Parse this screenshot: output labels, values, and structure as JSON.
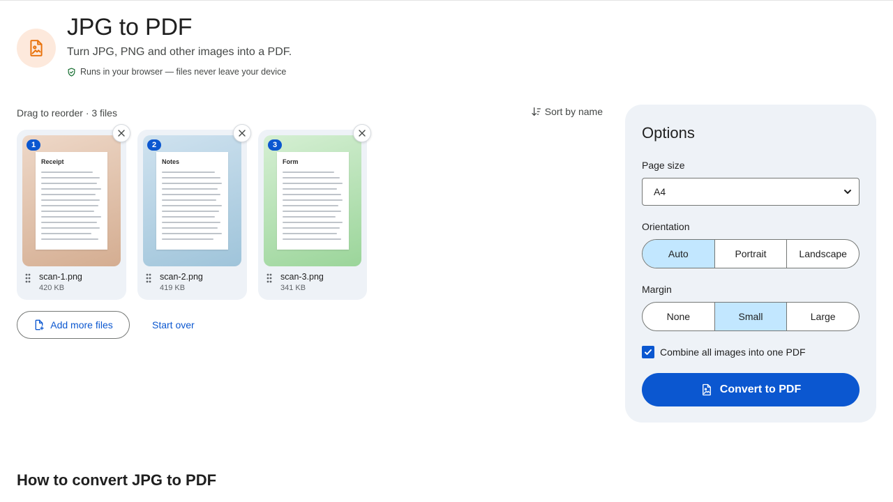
{
  "header": {
    "title": "JPG to PDF",
    "subtitle": "Turn JPG, PNG and other images into a PDF.",
    "privacy_note": "Runs in your browser — files never leave your device",
    "icon": "image-file-icon",
    "icon_bg": "#fde9dc",
    "icon_color": "#e8710a"
  },
  "files": {
    "meta": "Drag to reorder · 3 files",
    "sort_label": "Sort by name",
    "items": [
      {
        "index": "1",
        "doc_title": "Receipt",
        "name": "scan-1.png",
        "size": "420 KB",
        "gradient": [
          "#eed8c8",
          "#d4ad91"
        ]
      },
      {
        "index": "2",
        "doc_title": "Notes",
        "name": "scan-2.png",
        "size": "419 KB",
        "gradient": [
          "#cfe2ef",
          "#9fc4da"
        ]
      },
      {
        "index": "3",
        "doc_title": "Form",
        "name": "scan-3.png",
        "size": "341 KB",
        "gradient": [
          "#d5efd3",
          "#9bd59a"
        ]
      }
    ],
    "add_more_label": "Add more files",
    "start_over_label": "Start over"
  },
  "options": {
    "title": "Options",
    "page_size_label": "Page size",
    "page_size_value": "A4",
    "orientation_label": "Orientation",
    "orientation_options": [
      "Auto",
      "Portrait",
      "Landscape"
    ],
    "orientation_selected": "Auto",
    "margin_label": "Margin",
    "margin_options": [
      "None",
      "Small",
      "Large"
    ],
    "margin_selected": "Small",
    "combine_label": "Combine all images into one PDF",
    "combine_checked": true,
    "convert_label": "Convert to PDF"
  },
  "how_to": {
    "title": "How to convert JPG to PDF"
  },
  "colors": {
    "accent": "#0b57d0",
    "selected_segment": "#c2e7ff",
    "panel_bg": "#eef2f7"
  }
}
